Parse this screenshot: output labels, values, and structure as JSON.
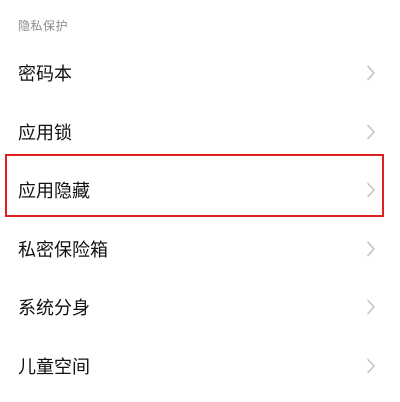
{
  "section": {
    "header": "隐私保护"
  },
  "settings": {
    "items": [
      {
        "label": "密码本",
        "icon": "chevron-right-icon"
      },
      {
        "label": "应用锁",
        "icon": "chevron-right-icon"
      },
      {
        "label": "应用隐藏",
        "icon": "chevron-right-icon",
        "highlighted": true
      },
      {
        "label": "私密保险箱",
        "icon": "chevron-right-icon"
      },
      {
        "label": "系统分身",
        "icon": "chevron-right-icon"
      },
      {
        "label": "儿童空间",
        "icon": "chevron-right-icon"
      }
    ]
  },
  "colors": {
    "highlight_border": "#e02020",
    "text_primary": "#111111",
    "text_secondary": "#8a8a8a",
    "chevron": "#c4c4c4"
  }
}
